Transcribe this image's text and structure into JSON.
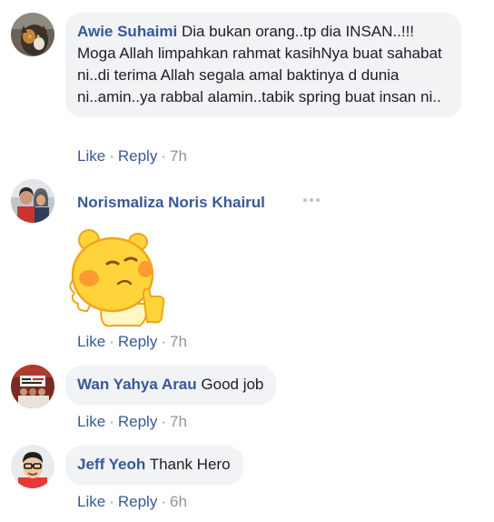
{
  "comments": [
    {
      "author": "Awie Suhaimi",
      "text": "Dia bukan orang..tp dia INSAN..!!! Moga Allah limpahkan rahmat kasihNya buat sahabat ni..di terima Allah segala amal baktinya d dunia ni..amin..ya rabbal alamin..tabik spring buat insan ni..",
      "like": "Like",
      "reply": "Reply",
      "sep": "·",
      "time": "7h"
    },
    {
      "author": "Norismaliza Noris Khairul",
      "like": "Like",
      "reply": "Reply",
      "sep": "·",
      "time": "7h",
      "sticker_icon": "thumbs-up-blob-sticker",
      "menu_icon": "more-dots-icon"
    },
    {
      "author": "Wan Yahya Arau",
      "text": "Good job",
      "like": "Like",
      "reply": "Reply",
      "sep": "·",
      "time": "7h"
    },
    {
      "author": "Jeff Yeoh",
      "text": "Thank Hero",
      "like": "Like",
      "reply": "Reply",
      "sep": "·",
      "time": "6h"
    }
  ],
  "colors": {
    "link": "#385898",
    "meta": "#90949c",
    "bubble": "#f2f3f5",
    "text": "#1c1e21"
  }
}
